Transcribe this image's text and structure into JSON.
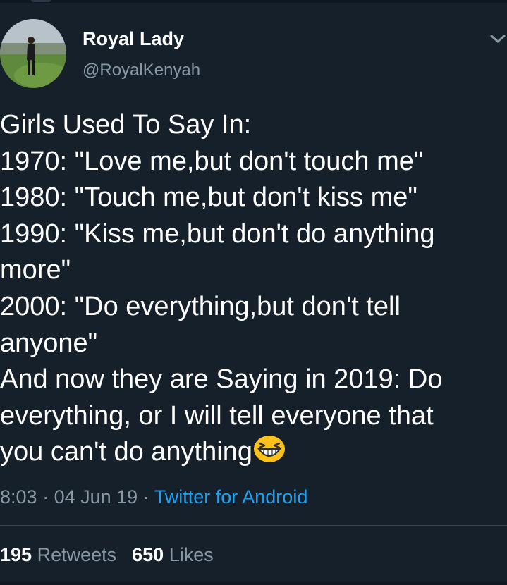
{
  "user": {
    "display_name": "Royal Lady",
    "handle": "@RoyalKenyah"
  },
  "tweet": {
    "lines": [
      "Girls Used To Say In:",
      "1970: \"Love me,but don't touch me\"",
      "1980: \"Touch me,but don't kiss me\"",
      "1990: \"Kiss me,but don't do anything",
      "more\"",
      "2000: \"Do everything,but don't tell",
      "anyone\"",
      "And now they are Saying in 2019: Do",
      "everything, or I will tell everyone that",
      "you can't do anything"
    ],
    "trailing_emoji": "grinning-squinting-face"
  },
  "meta": {
    "time": "8:03",
    "separator": "·",
    "date": "04 Jun 19",
    "client": "Twitter for Android"
  },
  "stats": {
    "retweets_count": "195",
    "retweets_label": "Retweets",
    "likes_count": "650",
    "likes_label": "Likes"
  },
  "colors": {
    "background": "#15202b",
    "text": "#ffffff",
    "muted": "#8899a6",
    "link": "#1da1f2",
    "divider": "#38444d"
  }
}
